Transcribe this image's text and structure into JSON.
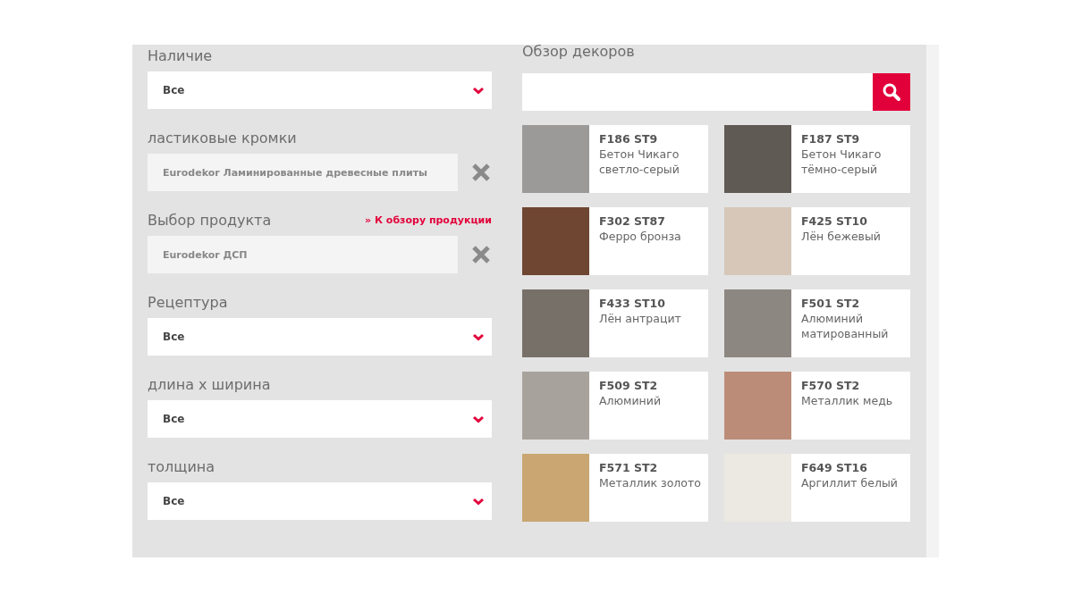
{
  "filters": [
    {
      "label": "Наличие",
      "kind": "select",
      "value": "Все"
    },
    {
      "label": "ластиковые кромки",
      "kind": "chosen",
      "value": "Eurodekor Ламинированные древесные плиты"
    },
    {
      "label": "Выбор продукта",
      "kind": "chosen",
      "value": "Eurodekor ДСП",
      "link": "» К обзору продукции"
    },
    {
      "label": "Рецептура",
      "kind": "select",
      "value": "Все"
    },
    {
      "label": "длина х ширина",
      "kind": "select",
      "value": "Все"
    },
    {
      "label": "толщина",
      "kind": "select",
      "value": "Все"
    }
  ],
  "decors": {
    "title": "Обзор декоров",
    "items": [
      {
        "code": "F186 ST9",
        "name": "Бетон Чикаго светло-серый",
        "color": "#9c9a98"
      },
      {
        "code": "F187 ST9",
        "name": "Бетон Чикаго тёмно-серый",
        "color": "#5f5a54"
      },
      {
        "code": "F302 ST87",
        "name": "Ферро бронза",
        "color": "#6e4632"
      },
      {
        "code": "F425 ST10",
        "name": "Лён бежевый",
        "color": "#d6c7b8"
      },
      {
        "code": "F433 ST10",
        "name": "Лён антрацит",
        "color": "#767069"
      },
      {
        "code": "F501 ST2",
        "name": "Алюминий матированный",
        "color": "#8d8782"
      },
      {
        "code": "F509 ST2",
        "name": "Алюминий",
        "color": "#a8a29d"
      },
      {
        "code": "F570 ST2",
        "name": "Металлик медь",
        "color": "#bb8d78"
      },
      {
        "code": "F571 ST2",
        "name": "Металлик золото",
        "color": "#c9a672"
      },
      {
        "code": "F649 ST16",
        "name": "Аргиллит белый",
        "color": "#ebe9e1"
      }
    ]
  }
}
